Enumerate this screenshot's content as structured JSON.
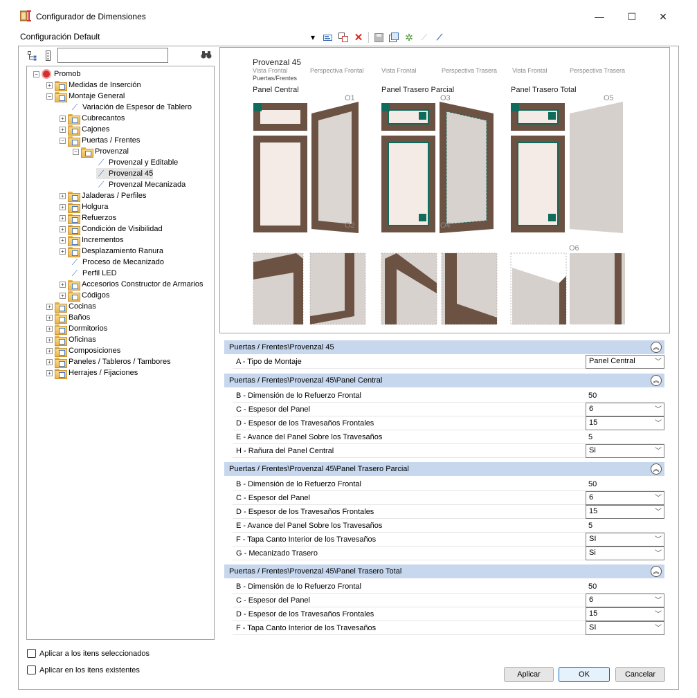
{
  "window": {
    "title": "Configurador de Dimensiones",
    "minimize": "—",
    "maximize": "☐",
    "close": "✕"
  },
  "config": {
    "label": "Configuración Default"
  },
  "tree": {
    "search_placeholder": "",
    "items": [
      {
        "label": "Promob"
      },
      {
        "label": "Medidas de Inserción"
      },
      {
        "label": "Montaje General"
      },
      {
        "label": "Variación de Espesor de Tablero"
      },
      {
        "label": "Cubrecantos"
      },
      {
        "label": "Cajones"
      },
      {
        "label": "Puertas / Frentes"
      },
      {
        "label": "Provenzal"
      },
      {
        "label": "Provenzal y Editable"
      },
      {
        "label": "Provenzal 45"
      },
      {
        "label": "Provenzal Mecanizada"
      },
      {
        "label": "Jaladeras / Perfiles"
      },
      {
        "label": "Holgura"
      },
      {
        "label": "Refuerzos"
      },
      {
        "label": "Condición de Visibilidad"
      },
      {
        "label": "Incrementos"
      },
      {
        "label": "Desplazamiento Ranura"
      },
      {
        "label": "Proceso de Mecanizado"
      },
      {
        "label": "Perfil LED"
      },
      {
        "label": "Accesorios Constructor de Armarios"
      },
      {
        "label": "Códigos"
      },
      {
        "label": "Cocinas"
      },
      {
        "label": "Baños"
      },
      {
        "label": "Dormitorios"
      },
      {
        "label": "Oficinas"
      },
      {
        "label": "Composiciones"
      },
      {
        "label": "Paneles / Tableros / Tambores"
      },
      {
        "label": "Herrajes / Fijaciones"
      }
    ]
  },
  "preview": {
    "title": "Provenzal 45",
    "subtitle1": "Vista Frontal",
    "subtitle2": "Puertas/Frentes",
    "col_labels": [
      "Perspectiva Frontal",
      "Vista Frontal",
      "Perspectiva Trasera",
      "Vista Frontal",
      "Perspectiva Trasera"
    ],
    "panels": [
      "Panel Central",
      "Panel Trasero Parcial",
      "Panel Trasero Total"
    ],
    "details": [
      "O1",
      "O2",
      "O3",
      "O4",
      "O5",
      "O6"
    ]
  },
  "sections": [
    {
      "title": "Puertas / Frentes\\Provenzal 45",
      "rows": [
        {
          "label": "A - Tipo de Montaje",
          "value": "Panel Central",
          "select": true
        }
      ]
    },
    {
      "title": "Puertas / Frentes\\Provenzal 45\\Panel Central",
      "rows": [
        {
          "label": "B - Dimensión de lo Refuerzo Frontal",
          "value": "50",
          "select": false
        },
        {
          "label": "C - Espesor del Panel",
          "value": "6",
          "select": true
        },
        {
          "label": "D - Espesor de los Travesaños Frontales",
          "value": "15",
          "select": true
        },
        {
          "label": "E - Avance del Panel Sobre los Travesaños",
          "value": "5",
          "select": false
        },
        {
          "label": "H - Rañura del Panel Central",
          "value": "Si",
          "select": true
        }
      ]
    },
    {
      "title": "Puertas / Frentes\\Provenzal 45\\Panel Trasero Parcial",
      "rows": [
        {
          "label": "B - Dimensión de lo Refuerzo Frontal",
          "value": "50",
          "select": false
        },
        {
          "label": "C - Espesor del Panel",
          "value": "6",
          "select": true
        },
        {
          "label": "D - Espesor de los Travesaños Frontales",
          "value": "15",
          "select": true
        },
        {
          "label": "E - Avance del Panel Sobre los Travesaños",
          "value": "5",
          "select": false
        },
        {
          "label": "F - Tapa Canto Interior de los Travesaños",
          "value": "SI",
          "select": true
        },
        {
          "label": "G - Mecanizado Trasero",
          "value": "Si",
          "select": true
        }
      ]
    },
    {
      "title": "Puertas / Frentes\\Provenzal 45\\Panel Trasero Total",
      "rows": [
        {
          "label": "B - Dimensión de lo Refuerzo Frontal",
          "value": "50",
          "select": false
        },
        {
          "label": "C - Espesor del Panel",
          "value": "6",
          "select": true
        },
        {
          "label": "D - Espesor de los Travesaños Frontales",
          "value": "15",
          "select": true
        },
        {
          "label": "F - Tapa Canto Interior de los Travesaños",
          "value": "SI",
          "select": true
        }
      ]
    }
  ],
  "options": {
    "apply_selected": "Aplicar a los itens seleccionados",
    "apply_existing": "Aplicar en los itens existentes"
  },
  "buttons": {
    "apply": "Aplicar",
    "ok": "OK",
    "cancel": "Cancelar"
  },
  "colors": {
    "section_header": "#c6d7ee",
    "frame_wood": "#6b5243",
    "accent_teal": "#0f6b5c"
  }
}
